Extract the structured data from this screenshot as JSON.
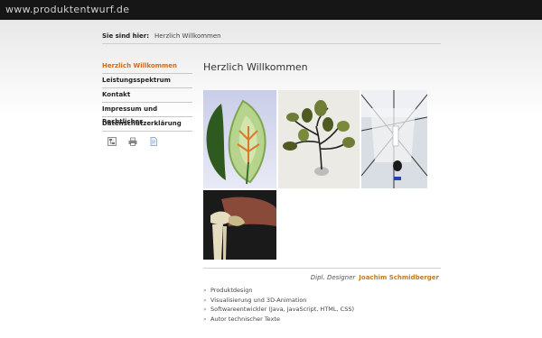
{
  "site": {
    "title": "www.produktentwurf.de"
  },
  "breadcrumb": {
    "label": "Sie sind hier:",
    "current": "Herzlich Willkommen"
  },
  "nav": {
    "items": [
      {
        "label": "Herzlich Willkommen"
      },
      {
        "label": "Leistungsspektrum"
      },
      {
        "label": "Kontakt"
      },
      {
        "label": "Impressum und Rechtliches"
      },
      {
        "label": "Datenschutzerklärung"
      }
    ]
  },
  "tools": {
    "icons": [
      "sitemap-icon",
      "print-icon",
      "document-icon"
    ]
  },
  "main": {
    "title": "Herzlich Willkommen"
  },
  "signature": {
    "role": "Dipl. Designer",
    "name": "Joachim Schmidberger"
  },
  "services": [
    "Produktdesign",
    "Visualisierung und 3D-Animation",
    "Softwareentwickler (Java, JavaScript, HTML, CSS)",
    "Autor technischer Texte"
  ],
  "colors": {
    "accent": "#d2691e",
    "topbar": "#161616",
    "signature_name": "#c27a22"
  }
}
